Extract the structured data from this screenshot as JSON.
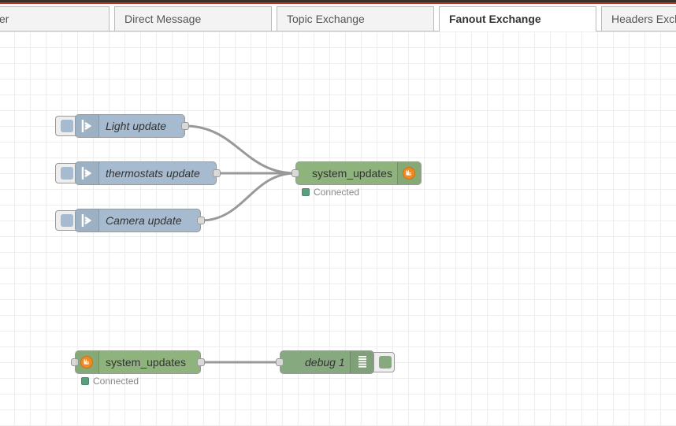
{
  "tabs": [
    {
      "label": "er",
      "active": false
    },
    {
      "label": "Direct Message",
      "active": false
    },
    {
      "label": "Topic Exchange",
      "active": false
    },
    {
      "label": "Fanout Exchange",
      "active": true
    },
    {
      "label": "Headers Exch",
      "active": false
    }
  ],
  "nodes": {
    "inject_light": {
      "label": "Light update",
      "type": "inject"
    },
    "inject_thermostats": {
      "label": "thermostats update",
      "type": "inject"
    },
    "inject_camera": {
      "label": "Camera update",
      "type": "inject"
    },
    "amqp_out": {
      "label": "system_updates",
      "type": "amqp-out",
      "status": "Connected"
    },
    "amqp_in": {
      "label": "system_updates",
      "type": "amqp-in",
      "status": "Connected"
    },
    "debug": {
      "label": "debug 1",
      "type": "debug"
    }
  },
  "colors": {
    "inject": "#a6bbcf",
    "amqp": "#8fb37c",
    "debug": "#87a980",
    "status_connected": "#5a9e7c",
    "amqp_badge": "#f08a24",
    "wire": "#999999"
  },
  "icons": {
    "inject": "arrow-in-icon",
    "amqp": "rabbitmq-icon",
    "debug": "list-icon"
  }
}
